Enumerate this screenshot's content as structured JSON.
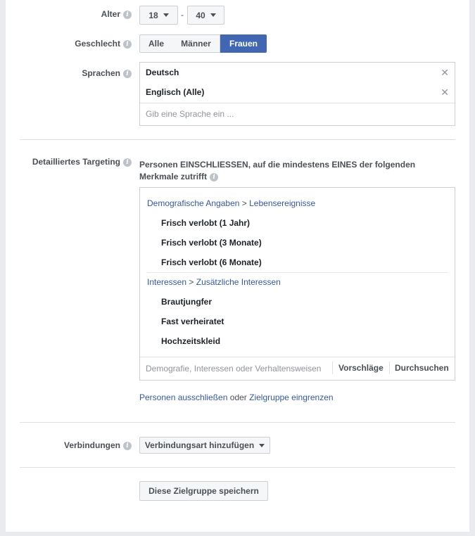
{
  "age": {
    "label": "Alter",
    "min": "18",
    "separator": "-",
    "max": "40"
  },
  "gender": {
    "label": "Geschlecht",
    "options": [
      "Alle",
      "Männer",
      "Frauen"
    ],
    "selected": "Frauen"
  },
  "languages": {
    "label": "Sprachen",
    "selected": [
      "Deutsch",
      "Englisch (Alle)"
    ],
    "placeholder": "Gib eine Sprache ein ..."
  },
  "detailed_targeting": {
    "label": "Detailliertes Targeting",
    "description": "Personen EINSCHLIESSEN, auf die mindestens EINES der folgenden Merkmale zutrifft",
    "groups": [
      {
        "path_parent": "Demografische Angaben",
        "path_sep": ">",
        "path_child": "Lebensereignisse",
        "items": [
          "Frisch verlobt (1 Jahr)",
          "Frisch verlobt (3 Monate)",
          "Frisch verlobt (6 Monate)"
        ]
      },
      {
        "path_parent": "Interessen",
        "path_sep": ">",
        "path_child": "Zusätzliche Interessen",
        "items": [
          "Brautjungfer",
          "Fast verheiratet",
          "Hochzeitskleid"
        ]
      }
    ],
    "search_placeholder": "Demografie, Interessen oder Verhaltensweisen",
    "suggestions_label": "Vorschläge",
    "browse_label": "Durchsuchen",
    "exclude_link": "Personen ausschließen",
    "or_text": "oder",
    "narrow_link": "Zielgruppe eingrenzen"
  },
  "connections": {
    "label": "Verbindungen",
    "dropdown": "Verbindungsart hinzufügen"
  },
  "save_button": "Diese Zielgruppe speichern",
  "colors": {
    "accent": "#4267b2",
    "link": "#365899",
    "page_bg": "#e9ebee"
  }
}
